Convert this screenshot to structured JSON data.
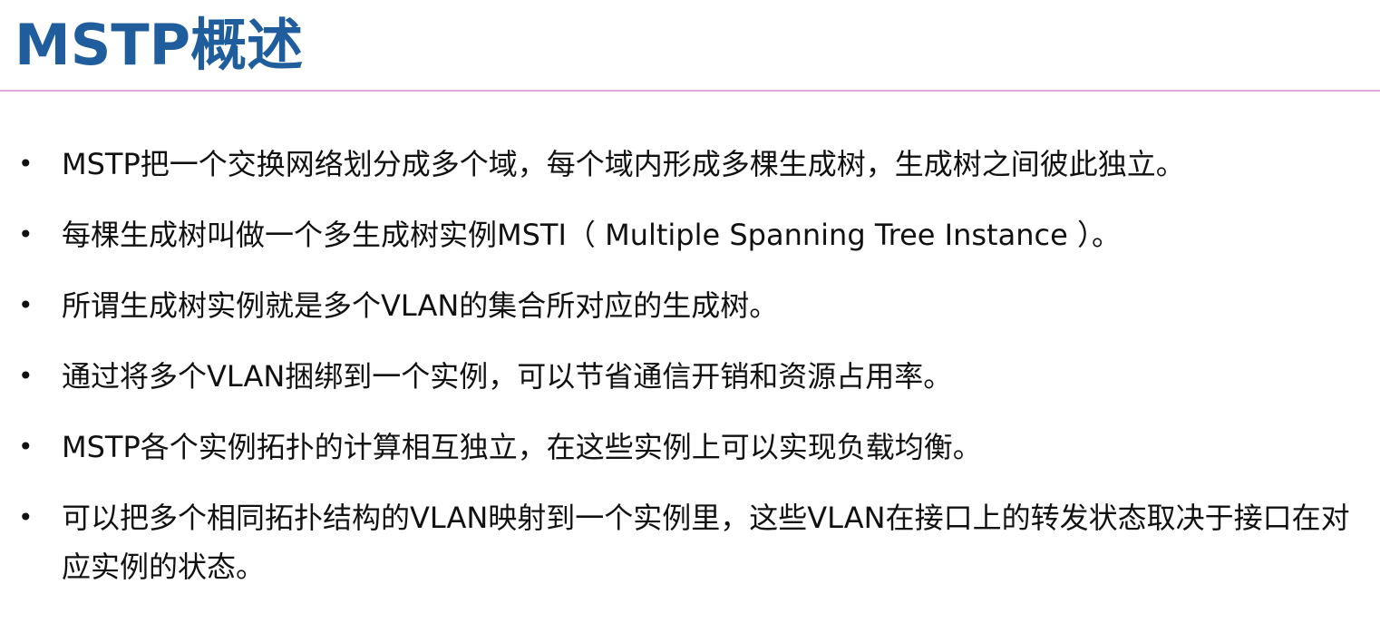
{
  "slide": {
    "title": "MSTP概述",
    "bullet_symbol": "•",
    "bullets": [
      "MSTP把一个交换网络划分成多个域，每个域内形成多棵生成树，生成树之间彼此独立。",
      "每棵生成树叫做一个多生成树实例MSTI（ Multiple Spanning Tree Instance ）。",
      "所谓生成树实例就是多个VLAN的集合所对应的生成树。",
      "通过将多个VLAN捆绑到一个实例，可以节省通信开销和资源占用率。",
      "MSTP各个实例拓扑的计算相互独立，在这些实例上可以实现负载均衡。",
      "可以把多个相同拓扑结构的VLAN映射到一个实例里，这些VLAN在接口上的转发状态取决于接口在对应实例的状态。"
    ]
  },
  "colors": {
    "title": "#1f5d9c",
    "rule": "#e3a8e0",
    "text": "#111111",
    "background": "#ffffff"
  }
}
